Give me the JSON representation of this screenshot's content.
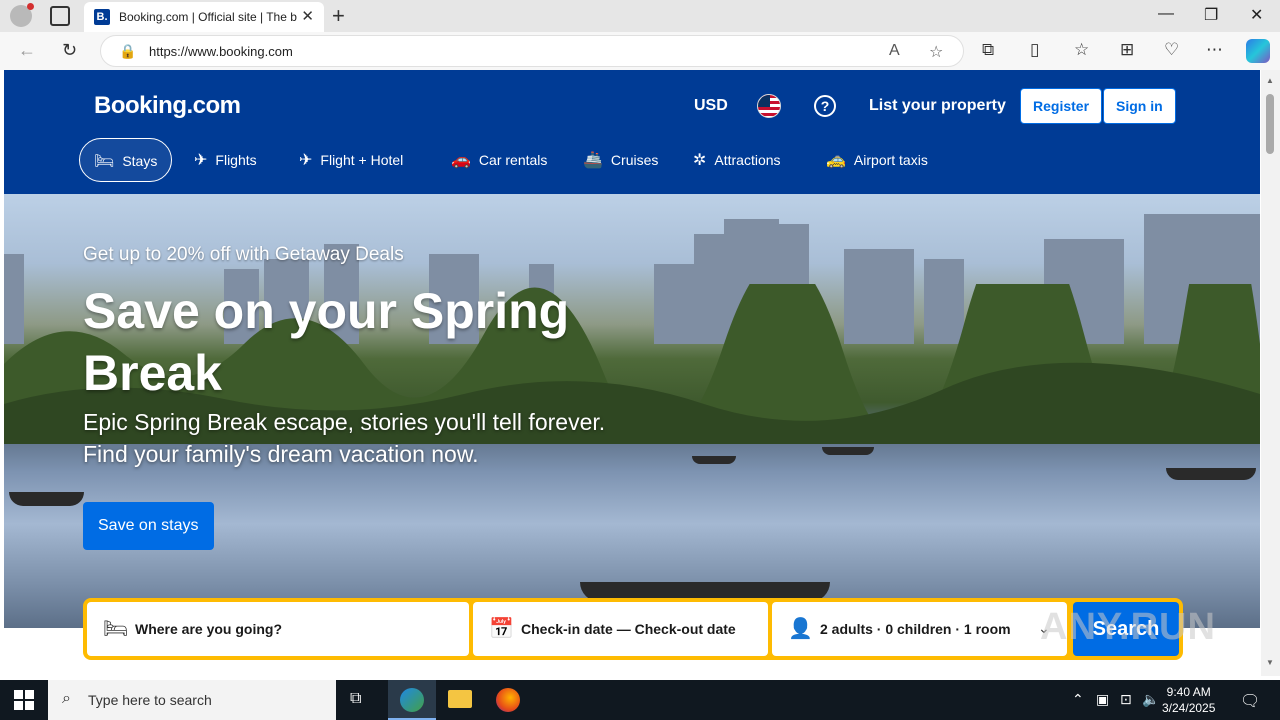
{
  "browser": {
    "tab_title": "Booking.com | Official site | The b",
    "tab_favicon": "B.",
    "url": "https://www.booking.com",
    "icons": [
      "profile-icon",
      "tab-actions-icon",
      "close-tab-icon",
      "new-tab-icon",
      "back-icon",
      "refresh-icon",
      "lock-icon",
      "read-aloud-icon",
      "favorite-icon",
      "extensions-icon",
      "split-screen-icon",
      "favorites-icon",
      "collections-icon",
      "browser-essentials-icon",
      "more-icon",
      "copilot-icon"
    ]
  },
  "header": {
    "logo": "Booking.com",
    "currency": "USD",
    "list_property": "List your property",
    "register": "Register",
    "sign_in": "Sign in",
    "help": "?"
  },
  "nav": [
    {
      "label": "Stays",
      "icon": "bed-icon",
      "glyph": "🛏",
      "active": true
    },
    {
      "label": "Flights",
      "icon": "plane-icon",
      "glyph": "✈"
    },
    {
      "label": "Flight + Hotel",
      "icon": "flight-hotel-icon",
      "glyph": "✈"
    },
    {
      "label": "Car rentals",
      "icon": "car-icon",
      "glyph": "🚗"
    },
    {
      "label": "Cruises",
      "icon": "ship-icon",
      "glyph": "🚢"
    },
    {
      "label": "Attractions",
      "icon": "attractions-icon",
      "glyph": "✲"
    },
    {
      "label": "Airport taxis",
      "icon": "taxi-icon",
      "glyph": "🚕"
    }
  ],
  "hero": {
    "subtitle": "Get up to 20% off with Getaway Deals",
    "title": "Save on your Spring Break",
    "text_line1": "Epic Spring Break escape, stories you'll tell forever.",
    "text_line2": "Find your family's dream vacation now.",
    "cta": "Save on stays"
  },
  "search": {
    "destination_placeholder": "Where are you going?",
    "dates": "Check-in date  —  Check-out date",
    "guests": "2 adults · 0 children · 1 room",
    "button": "Search"
  },
  "watermark": "ANY.RUN",
  "taskbar": {
    "search_placeholder": "Type here to search",
    "time": "9:40 AM",
    "date": "3/24/2025"
  }
}
